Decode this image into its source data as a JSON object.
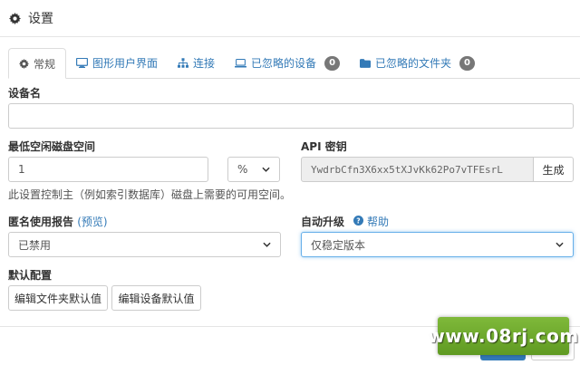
{
  "header": {
    "title": "设置",
    "icon": "gear-icon"
  },
  "tabs": [
    {
      "label": "常规",
      "icon": "gear-icon",
      "active": true
    },
    {
      "label": "图形用户界面",
      "icon": "desktop-icon"
    },
    {
      "label": "连接",
      "icon": "sitemap-icon"
    },
    {
      "label": "已忽略的设备",
      "icon": "laptop-icon",
      "badge": "0"
    },
    {
      "label": "已忽略的文件夹",
      "icon": "folder-icon",
      "badge": "0"
    }
  ],
  "device_name": {
    "label": "设备名",
    "value": ""
  },
  "min_disk": {
    "label": "最低空闲磁盘空间",
    "value": "1",
    "unit": "%",
    "help": "此设置控制主（例如索引数据库）磁盘上需要的可用空间。"
  },
  "api_key": {
    "label": "API 密钥",
    "value": "YwdrbCfn3X6xx5tXJvKk62Po7vTFEsrL",
    "generate_label": "生成"
  },
  "usage_report": {
    "label": "匿名使用报告",
    "preview_label": "(预览)",
    "value": "已禁用"
  },
  "auto_upgrade": {
    "label": "自动升级",
    "help_label": "帮助",
    "value": "仅稳定版本"
  },
  "defaults": {
    "label": "默认配置",
    "edit_folder_label": "编辑文件夹默认值",
    "edit_device_label": "编辑设备默认值"
  },
  "watermark": {
    "text": "www.08rj.com"
  },
  "colors": {
    "link": "#337ab7",
    "badge": "#777777",
    "watermark": "#6aa82c"
  }
}
